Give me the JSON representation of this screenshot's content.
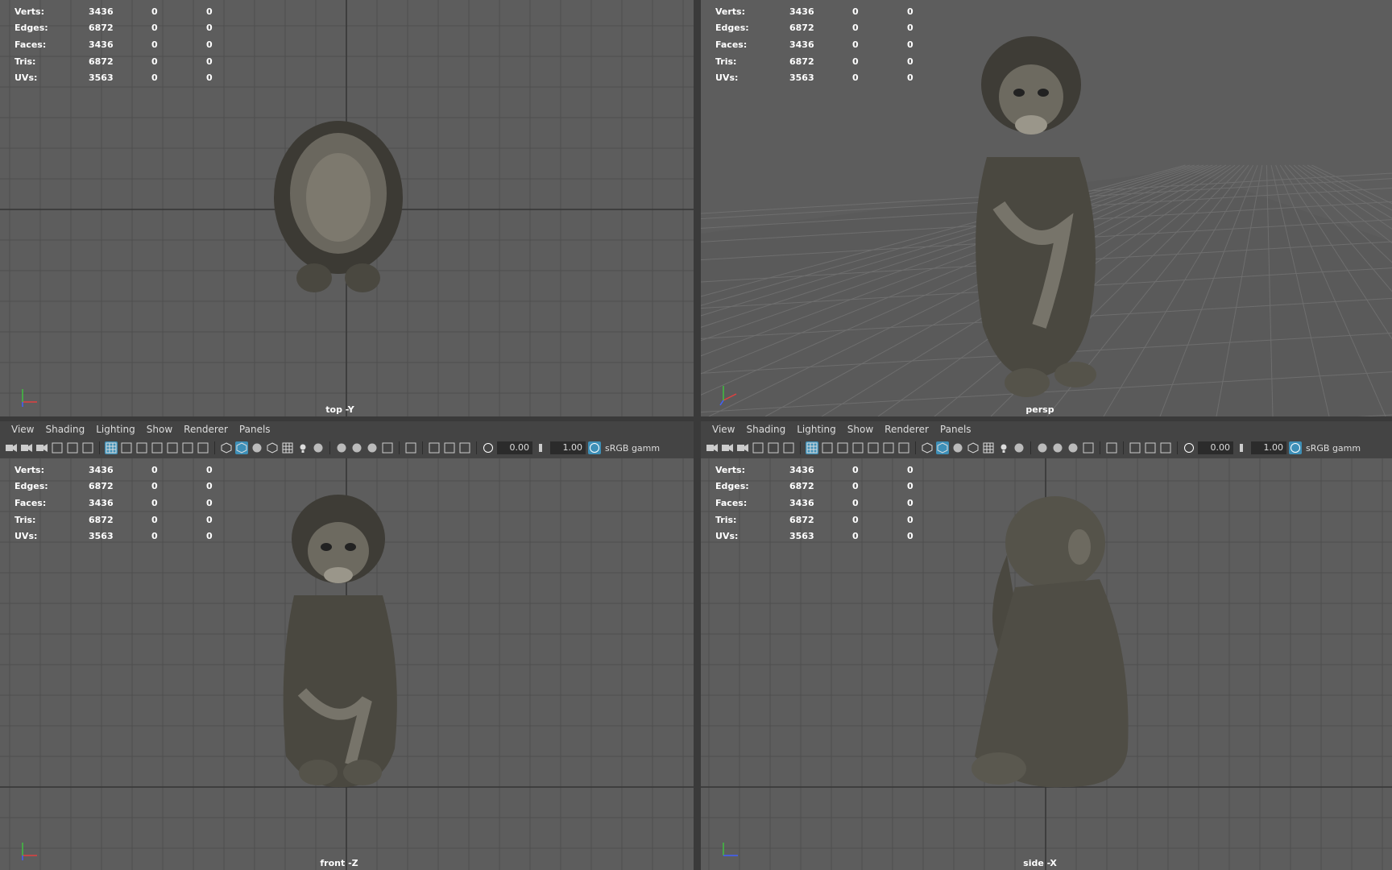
{
  "hud_rows": [
    {
      "label": "Verts:",
      "v1": "3436",
      "v2": "0",
      "v3": "0"
    },
    {
      "label": "Edges:",
      "v1": "6872",
      "v2": "0",
      "v3": "0"
    },
    {
      "label": "Faces:",
      "v1": "3436",
      "v2": "0",
      "v3": "0"
    },
    {
      "label": "Tris:",
      "v1": "6872",
      "v2": "0",
      "v3": "0"
    },
    {
      "label": "UVs:",
      "v1": "3563",
      "v2": "0",
      "v3": "0"
    }
  ],
  "menu": [
    "View",
    "Shading",
    "Lighting",
    "Show",
    "Renderer",
    "Panels"
  ],
  "toolbar": {
    "field1": "0.00",
    "field2": "1.00",
    "color_space": "sRGB gamm"
  },
  "viewports": {
    "top": {
      "label": "top -Y"
    },
    "persp": {
      "label": "persp"
    },
    "front": {
      "label": "front -Z"
    },
    "side": {
      "label": "side -X"
    }
  },
  "icons": [
    "camera-icon",
    "grid-icon",
    "wireframe-icon",
    "smooth-shade-icon",
    "textured-icon",
    "light-icon",
    "isolate-icon",
    "gamma-icon"
  ],
  "colors": {
    "viewport_bg": "#5d5d5d",
    "grid_line": "#4f4f4f",
    "grid_axis": "#3a3a3a",
    "active_icon": "#3d8fb7",
    "statue": "#4a4840"
  }
}
